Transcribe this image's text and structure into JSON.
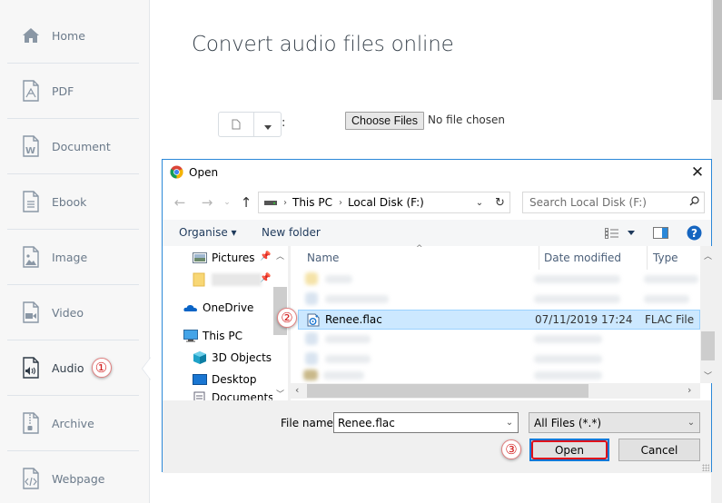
{
  "sidebar": {
    "items": [
      {
        "label": "Home",
        "icon": "home-icon"
      },
      {
        "label": "PDF",
        "icon": "pdf-file-icon"
      },
      {
        "label": "Document",
        "icon": "word-file-icon"
      },
      {
        "label": "Ebook",
        "icon": "ebook-file-icon"
      },
      {
        "label": "Image",
        "icon": "image-file-icon"
      },
      {
        "label": "Video",
        "icon": "video-file-icon"
      },
      {
        "label": "Audio",
        "icon": "audio-file-icon",
        "active": true
      },
      {
        "label": "Archive",
        "icon": "archive-file-icon"
      },
      {
        "label": "Webpage",
        "icon": "webpage-file-icon"
      }
    ],
    "step_marker": "①"
  },
  "main": {
    "title": "Convert audio files online",
    "colon": ":",
    "choose_files_label": "Choose Files",
    "no_file_text": "No file chosen"
  },
  "dialog": {
    "title": "Open",
    "close": "✕",
    "breadcrumb": [
      "This PC",
      "Local Disk (F:)"
    ],
    "search_placeholder": "Search Local Disk (F:)",
    "toolbar": {
      "organise": "Organise ▾",
      "new_folder": "New folder"
    },
    "nav_pane": [
      {
        "label": "Pictures",
        "icon": "pictures-icon",
        "pinned": true
      },
      {
        "label": "",
        "icon": "folder-icon",
        "pinned": true,
        "blurred": true
      },
      {
        "label": "OneDrive",
        "icon": "onedrive-icon"
      },
      {
        "label": "This PC",
        "icon": "this-pc-icon"
      },
      {
        "label": "3D Objects",
        "icon": "3d-objects-icon"
      },
      {
        "label": "Desktop",
        "icon": "desktop-icon"
      },
      {
        "label": "Documents",
        "icon": "documents-icon"
      }
    ],
    "columns": {
      "name": "Name",
      "date": "Date modified",
      "type": "Type"
    },
    "selected_file": {
      "name": "Renee.flac",
      "date": "07/11/2019 17:24",
      "type": "FLAC File"
    },
    "step_marker_2": "②",
    "step_marker_3": "③",
    "file_name_label": "File name:",
    "file_name_value": "Renee.flac",
    "file_type_value": "All Files (*.*)",
    "open_label": "Open",
    "cancel_label": "Cancel"
  },
  "colors": {
    "accent": "#2b88d8",
    "selection": "#cce8ff",
    "highlight": "#e0101a"
  }
}
